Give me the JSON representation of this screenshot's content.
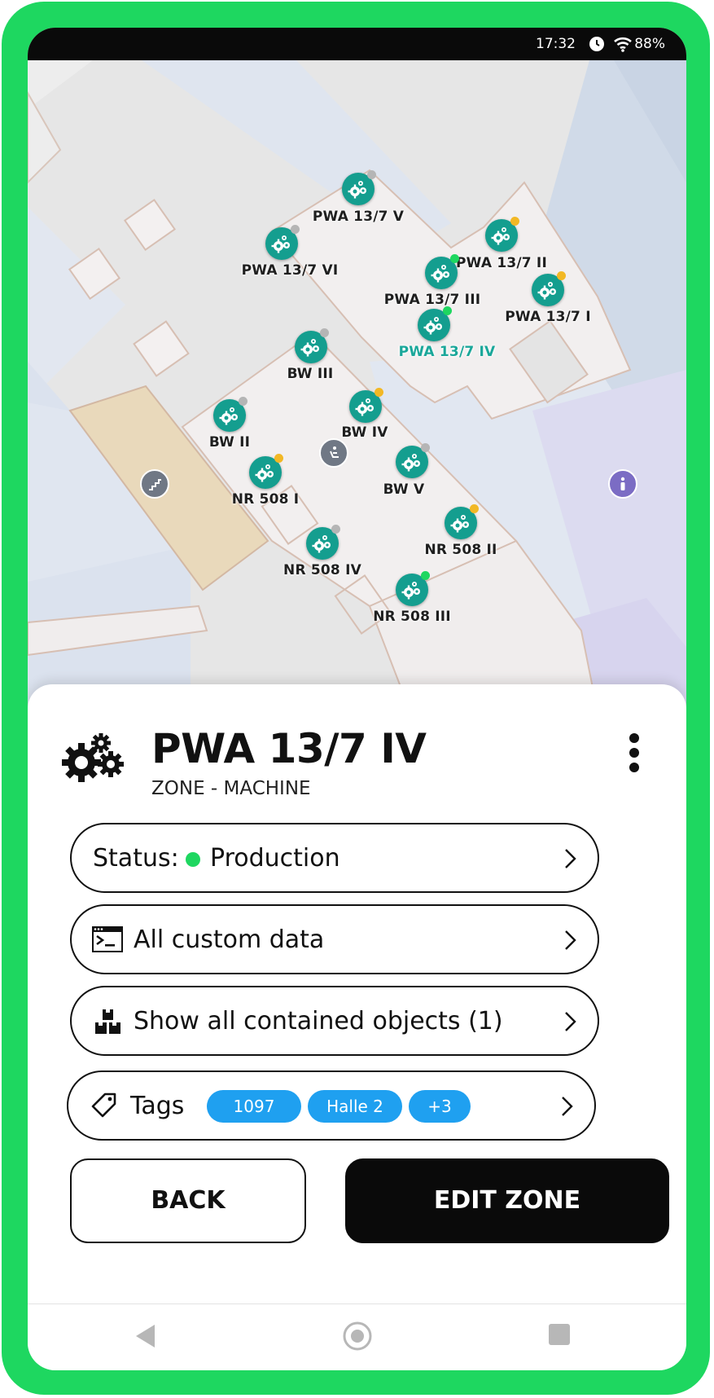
{
  "status_bar": {
    "time": "17:32",
    "battery": "88%"
  },
  "map": {
    "markers": [
      {
        "label": "PWA 13/7 V",
        "status_color": "#b5b5b5"
      },
      {
        "label": "PWA 13/7 VI",
        "status_color": "#b5b5b5"
      },
      {
        "label": "PWA 13/7 II",
        "status_color": "#f2b825"
      },
      {
        "label": "PWA 13/7 III",
        "status_color": "#1ed760"
      },
      {
        "label": "PWA 13/7 I",
        "status_color": "#f2b825"
      },
      {
        "label": "PWA 13/7 IV",
        "status_color": "#1ed760"
      },
      {
        "label": "BW III",
        "status_color": "#b5b5b5"
      },
      {
        "label": "BW IV",
        "status_color": "#f2b825"
      },
      {
        "label": "BW II",
        "status_color": "#b5b5b5"
      },
      {
        "label": "BW V",
        "status_color": "#b5b5b5"
      },
      {
        "label": "NR 508 I",
        "status_color": "#f2b825"
      },
      {
        "label": "NR 508 II",
        "status_color": "#f2b825"
      },
      {
        "label": "NR 508 IV",
        "status_color": "#b5b5b5"
      },
      {
        "label": "NR 508 III",
        "status_color": "#1ed760"
      }
    ],
    "active_marker": "PWA 13/7 IV"
  },
  "sheet": {
    "title": "PWA 13/7 IV",
    "subtitle": "ZONE - MACHINE",
    "status_label": "Status:",
    "status_value": "Production",
    "custom_data_label": "All custom data",
    "contained_label": "Show all contained objects (1)",
    "tags_label": "Tags",
    "tags": [
      "1097",
      "Halle 2",
      "+3"
    ],
    "back_label": "BACK",
    "edit_label": "EDIT ZONE"
  },
  "colors": {
    "accent": "#1ed760",
    "marker": "#149e8f",
    "tag": "#1fa0f0"
  }
}
